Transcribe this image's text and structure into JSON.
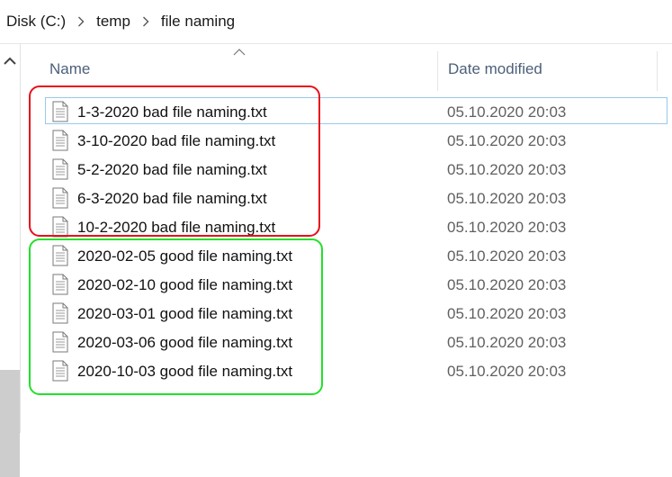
{
  "breadcrumb": {
    "items": [
      "Disk (C:)",
      "temp",
      "file naming"
    ]
  },
  "columns": {
    "name": "Name",
    "date_modified": "Date modified"
  },
  "files": [
    {
      "name": "1-3-2020 bad file naming.txt",
      "date": "05.10.2020 20:03",
      "group": "bad"
    },
    {
      "name": "3-10-2020 bad file naming.txt",
      "date": "05.10.2020 20:03",
      "group": "bad"
    },
    {
      "name": "5-2-2020 bad file naming.txt",
      "date": "05.10.2020 20:03",
      "group": "bad"
    },
    {
      "name": "6-3-2020 bad file naming.txt",
      "date": "05.10.2020 20:03",
      "group": "bad"
    },
    {
      "name": "10-2-2020 bad file naming.txt",
      "date": "05.10.2020 20:03",
      "group": "bad"
    },
    {
      "name": "2020-02-05 good file naming.txt",
      "date": "05.10.2020 20:03",
      "group": "good"
    },
    {
      "name": "2020-02-10 good file naming.txt",
      "date": "05.10.2020 20:03",
      "group": "good"
    },
    {
      "name": "2020-03-01 good file naming.txt",
      "date": "05.10.2020 20:03",
      "group": "good"
    },
    {
      "name": "2020-03-06 good file naming.txt",
      "date": "05.10.2020 20:03",
      "group": "good"
    },
    {
      "name": "2020-10-03 good file naming.txt",
      "date": "05.10.2020 20:03",
      "group": "good"
    }
  ],
  "colors": {
    "bad_highlight": "#e8101a",
    "good_highlight": "#22e02a",
    "header_text": "#4c607a",
    "selection_border": "#99c9e9"
  },
  "icons": {
    "breadcrumb_separator": "chevron-right-icon",
    "file": "text-file-icon",
    "sort": "sort-ascending-icon",
    "scroll_up": "chevron-up-icon"
  }
}
